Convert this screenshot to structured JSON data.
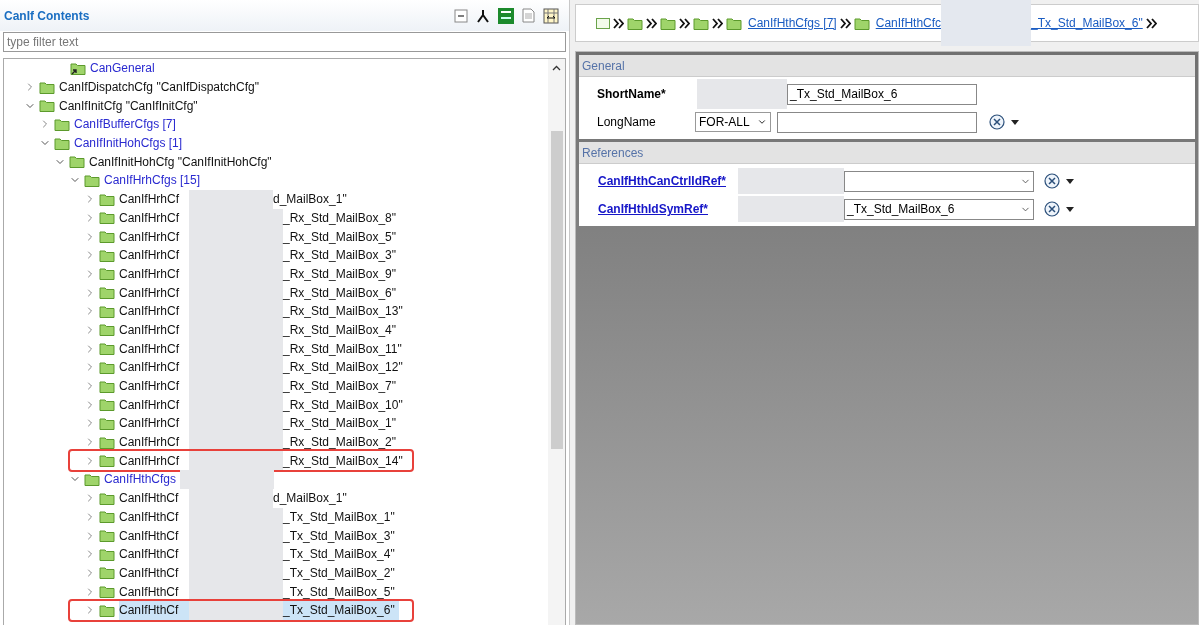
{
  "panel": {
    "title": "CanIf Contents",
    "filter_placeholder": "type filter text"
  },
  "tree": [
    {
      "kind": "link",
      "label": "CanGeneral"
    },
    {
      "kind": "container",
      "label": "CanIfDispatchCfg \"CanIfDispatchCfg\"",
      "expanded": false
    },
    {
      "kind": "container",
      "label": "CanIfInitCfg \"CanIfInitCfg\"",
      "expanded": true,
      "children": [
        {
          "kind": "group",
          "label": "CanIfBufferCfgs [7]",
          "expanded": false
        },
        {
          "kind": "group",
          "label": "CanIfInitHohCfgs [1]",
          "expanded": true,
          "children": [
            {
              "kind": "container",
              "label": "CanIfInitHohCfg \"CanIfInitHohCfg\"",
              "expanded": true,
              "children": [
                {
                  "kind": "group",
                  "label": "CanIfHrhCfgs [15]",
                  "expanded": true,
                  "children": [
                    {
                      "kind": "container",
                      "label": "CanIfHrhCf",
                      "label_end": "d_MailBox_1\"",
                      "expanded": false,
                      "selected": false,
                      "outlined": false
                    },
                    {
                      "kind": "container",
                      "label": "CanIfHrhCf",
                      "label_end": "_Rx_Std_MailBox_8\"",
                      "expanded": false,
                      "selected": false,
                      "outlined": false
                    },
                    {
                      "kind": "container",
                      "label": "CanIfHrhCf",
                      "label_end": "_Rx_Std_MailBox_5\"",
                      "expanded": false,
                      "selected": false,
                      "outlined": false
                    },
                    {
                      "kind": "container",
                      "label": "CanIfHrhCf",
                      "label_end": "_Rx_Std_MailBox_3\"",
                      "expanded": false,
                      "selected": false,
                      "outlined": false
                    },
                    {
                      "kind": "container",
                      "label": "CanIfHrhCf",
                      "label_end": "_Rx_Std_MailBox_9\"",
                      "expanded": false,
                      "selected": false,
                      "outlined": false
                    },
                    {
                      "kind": "container",
                      "label": "CanIfHrhCf",
                      "label_end": "_Rx_Std_MailBox_6\"",
                      "expanded": false,
                      "selected": false,
                      "outlined": false
                    },
                    {
                      "kind": "container",
                      "label": "CanIfHrhCf",
                      "label_end": "_Rx_Std_MailBox_13\"",
                      "expanded": false,
                      "selected": false,
                      "outlined": false
                    },
                    {
                      "kind": "container",
                      "label": "CanIfHrhCf",
                      "label_end": "_Rx_Std_MailBox_4\"",
                      "expanded": false,
                      "selected": false,
                      "outlined": false
                    },
                    {
                      "kind": "container",
                      "label": "CanIfHrhCf",
                      "label_end": "_Rx_Std_MailBox_11\"",
                      "expanded": false,
                      "selected": false,
                      "outlined": false
                    },
                    {
                      "kind": "container",
                      "label": "CanIfHrhCf",
                      "label_end": "_Rx_Std_MailBox_12\"",
                      "expanded": false,
                      "selected": false,
                      "outlined": false
                    },
                    {
                      "kind": "container",
                      "label": "CanIfHrhCf",
                      "label_end": "_Rx_Std_MailBox_7\"",
                      "expanded": false,
                      "selected": false,
                      "outlined": false
                    },
                    {
                      "kind": "container",
                      "label": "CanIfHrhCf",
                      "label_end": "_Rx_Std_MailBox_10\"",
                      "expanded": false,
                      "selected": false,
                      "outlined": false
                    },
                    {
                      "kind": "container",
                      "label": "CanIfHrhCf",
                      "label_end": "_Rx_Std_MailBox_1\"",
                      "expanded": false,
                      "selected": false,
                      "outlined": false
                    },
                    {
                      "kind": "container",
                      "label": "CanIfHrhCf",
                      "label_end": "_Rx_Std_MailBox_2\"",
                      "expanded": false,
                      "selected": false,
                      "outlined": false
                    },
                    {
                      "kind": "container",
                      "label": "CanIfHrhCf",
                      "label_end": "_Rx_Std_MailBox_14\"",
                      "expanded": false,
                      "selected": false,
                      "outlined": true
                    }
                  ]
                },
                {
                  "kind": "group",
                  "label": "CanIfHthCfgs",
                  "redacted_tail": true,
                  "expanded": true,
                  "children": [
                    {
                      "kind": "container",
                      "label": "CanIfHthCf",
                      "label_end": "d_MailBox_1\"",
                      "expanded": false,
                      "selected": false,
                      "outlined": false
                    },
                    {
                      "kind": "container",
                      "label": "CanIfHthCf",
                      "label_end": "_Tx_Std_MailBox_1\"",
                      "expanded": false,
                      "selected": false,
                      "outlined": false
                    },
                    {
                      "kind": "container",
                      "label": "CanIfHthCf",
                      "label_end": "_Tx_Std_MailBox_3\"",
                      "expanded": false,
                      "selected": false,
                      "outlined": false
                    },
                    {
                      "kind": "container",
                      "label": "CanIfHthCf",
                      "label_end": "_Tx_Std_MailBox_4\"",
                      "expanded": false,
                      "selected": false,
                      "outlined": false
                    },
                    {
                      "kind": "container",
                      "label": "CanIfHthCf",
                      "label_end": "_Tx_Std_MailBox_2\"",
                      "expanded": false,
                      "selected": false,
                      "outlined": false
                    },
                    {
                      "kind": "container",
                      "label": "CanIfHthCf",
                      "label_end": "_Tx_Std_MailBox_5\"",
                      "expanded": false,
                      "selected": false,
                      "outlined": false
                    },
                    {
                      "kind": "container",
                      "label": "CanIfHthCf",
                      "label_end": "_Tx_Std_MailBox_6\"",
                      "expanded": false,
                      "selected": true,
                      "outlined": true
                    }
                  ]
                }
              ]
            }
          ]
        }
      ]
    }
  ],
  "breadcrumb": [
    {
      "kind": "root"
    },
    {
      "kind": "folder"
    },
    {
      "kind": "folder"
    },
    {
      "kind": "folder"
    },
    {
      "kind": "link",
      "label": "CanIfHthCfgs [7]"
    },
    {
      "kind": "link",
      "label": "CanIfHthCfc",
      "label_end": "_Tx_Std_MailBox_6\""
    }
  ],
  "sections": [
    {
      "title": "General",
      "fields": [
        {
          "kind": "text",
          "label": "ShortName*",
          "value": "_Tx_Std_MailBox_6"
        },
        {
          "kind": "multilang",
          "label": "LongName",
          "language": "FOR-ALL"
        }
      ]
    },
    {
      "title": "References",
      "fields": [
        {
          "kind": "reference",
          "label": "CanIfHthCanCtrlIdRef*"
        },
        {
          "kind": "reference",
          "label": "CanIfHthIdSymRef*",
          "value": "_Tx_Std_MailBox_6"
        }
      ]
    }
  ]
}
